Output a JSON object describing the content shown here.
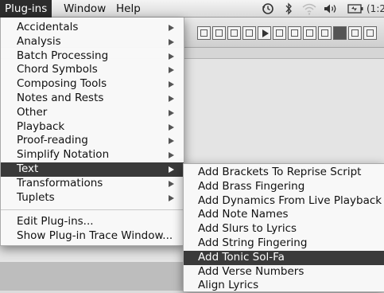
{
  "menubar": {
    "menus": [
      "Plug-ins",
      "Window",
      "Help"
    ],
    "active_menu": "Plug-ins",
    "status_icons": [
      "time-machine-icon",
      "bluetooth-icon",
      "wifi-icon",
      "volume-icon",
      "battery-icon"
    ],
    "clock": "(1:2"
  },
  "plugins_menu": {
    "items": [
      {
        "label": "Accidentals",
        "submenu": true
      },
      {
        "label": "Analysis",
        "submenu": true
      },
      {
        "label": "Batch Processing",
        "submenu": true
      },
      {
        "label": "Chord Symbols",
        "submenu": true
      },
      {
        "label": "Composing Tools",
        "submenu": true
      },
      {
        "label": "Notes and Rests",
        "submenu": true
      },
      {
        "label": "Other",
        "submenu": true
      },
      {
        "label": "Playback",
        "submenu": true
      },
      {
        "label": "Proof-reading",
        "submenu": true
      },
      {
        "label": "Simplify Notation",
        "submenu": true
      },
      {
        "label": "Text",
        "submenu": true,
        "highlighted": true
      },
      {
        "label": "Transformations",
        "submenu": true
      },
      {
        "label": "Tuplets",
        "submenu": true
      }
    ],
    "footer_items": [
      {
        "label": "Edit Plug-ins..."
      },
      {
        "label": "Show Plug-in Trace Window..."
      }
    ]
  },
  "text_submenu": {
    "items": [
      {
        "label": "Add Brackets To Reprise Script"
      },
      {
        "label": "Add Brass Fingering"
      },
      {
        "label": "Add Dynamics From Live Playback"
      },
      {
        "label": "Add Note Names"
      },
      {
        "label": "Add Slurs to Lyrics"
      },
      {
        "label": "Add String Fingering"
      },
      {
        "label": "Add Tonic Sol-Fa",
        "highlighted": true
      },
      {
        "label": "Add Verse Numbers"
      },
      {
        "label": "Align Lyrics"
      }
    ]
  },
  "colors": {
    "highlight": "#3a3a3a",
    "menu_background": "#f8f8f8",
    "menubar_background": "#e6e6e6"
  }
}
